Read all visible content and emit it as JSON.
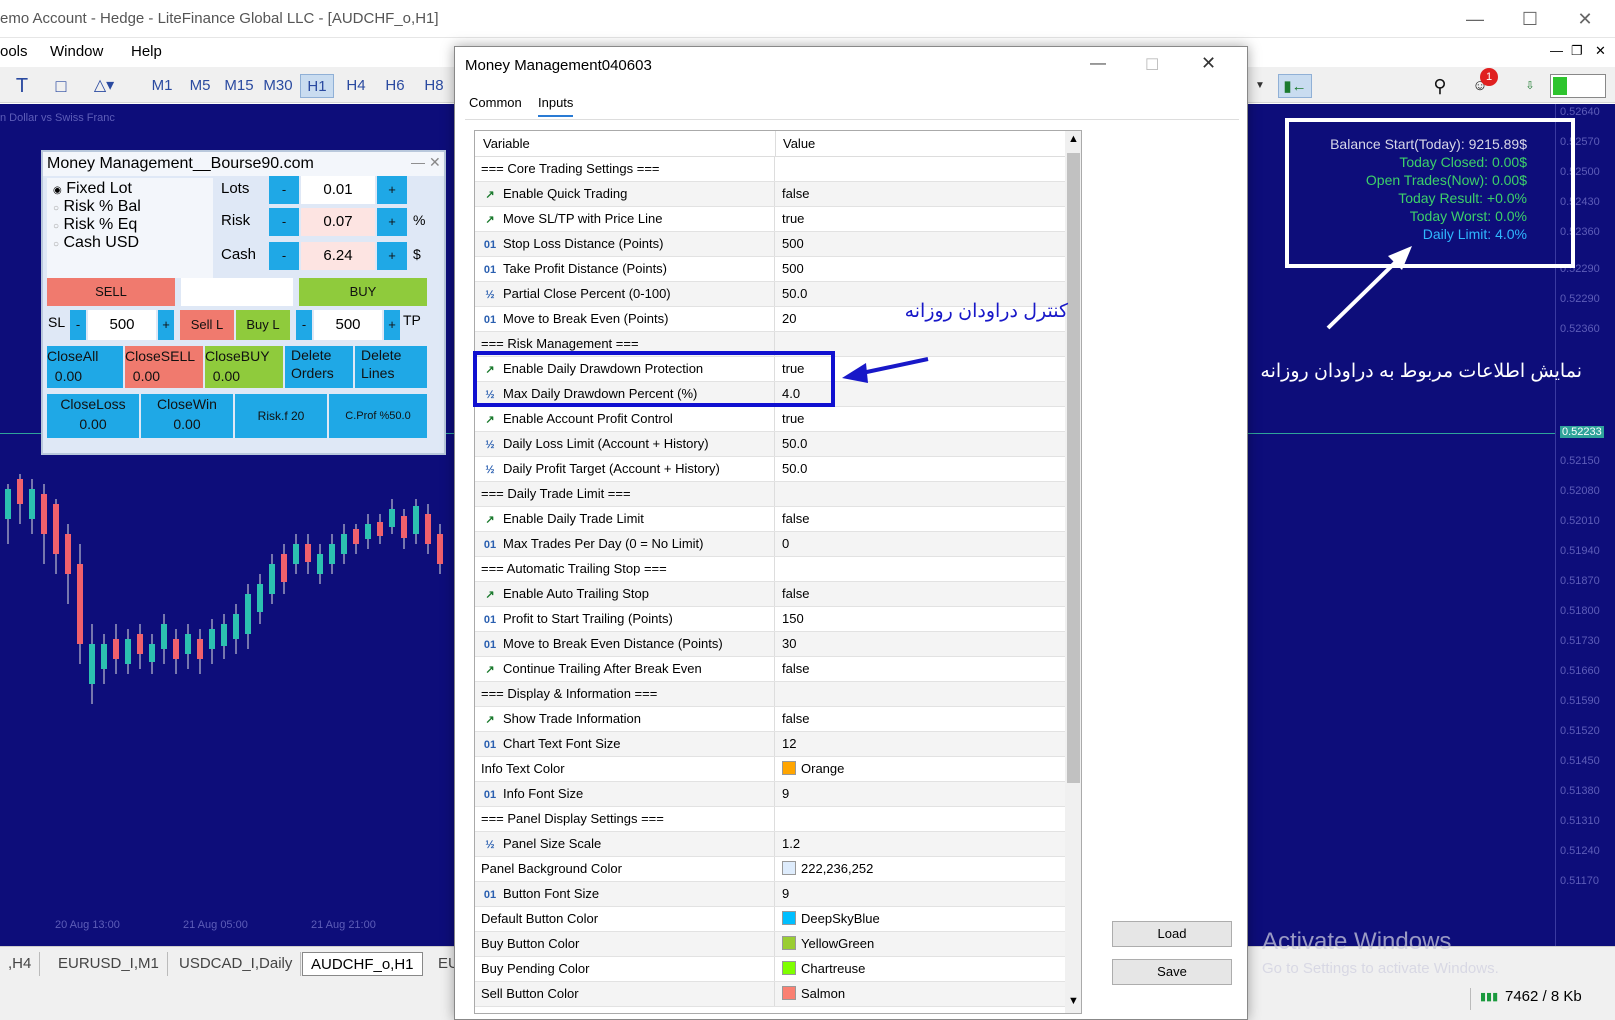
{
  "window": {
    "title": "emo Account - Hedge - LiteFinance Global LLC - [AUDCHF_o,H1]"
  },
  "menu": [
    "ools",
    "Window",
    "Help"
  ],
  "timeframes": [
    "M1",
    "M5",
    "M15",
    "M30",
    "H1",
    "H4",
    "H6",
    "H8"
  ],
  "chart": {
    "symbol_label": "n Dollar vs Swiss Franc",
    "prices": [
      "0.52640",
      "0.52570",
      "0.52500",
      "0.52430",
      "0.52360",
      "0.52290",
      "0.52220",
      "0.52150",
      "0.52080",
      "0.52010",
      "0.51940",
      "0.51870",
      "0.51800",
      "0.51730",
      "0.51660",
      "0.51590",
      "0.51520",
      "0.51450",
      "0.51380",
      "0.51310",
      "0.51240",
      "0.51170"
    ],
    "current_price": "0.52233",
    "time_labels": [
      "20 Aug 13:00",
      "21 Aug 05:00",
      "21 Aug 21:00"
    ]
  },
  "panel": {
    "title": "Money Management__Bourse90.com",
    "modes": [
      "Fixed Lot",
      "Risk % Bal",
      "Risk % Eq",
      "Cash USD"
    ],
    "lots_label": "Lots",
    "lots": "0.01",
    "risk_label": "Risk",
    "risk": "0.07",
    "risk_unit": "%",
    "cash_label": "Cash",
    "cash": "6.24",
    "cash_unit": "$",
    "minus": "-",
    "plus": "+",
    "sell": "SELL",
    "buy": "BUY",
    "sl_label": "SL",
    "sl": "500",
    "sell_l": "Sell L",
    "buy_l": "Buy L",
    "tp": "500",
    "tp_label": "TP",
    "close_all": "CloseAll",
    "close_all_val": "0.00",
    "close_sell": "CloseSELL",
    "close_sell_val": "0.00",
    "close_buy": "CloseBUY",
    "close_buy_val": "0.00",
    "delete_orders": "Delete Orders",
    "delete_lines": "Delete Lines",
    "close_loss": "CloseLoss",
    "close_loss_val": "0.00",
    "close_win": "CloseWin",
    "close_win_val": "0.00",
    "risk_f": "Risk.f 20",
    "c_prof": "C.Prof %50.0"
  },
  "info": {
    "balance": "Balance Start(Today): 9215.89$",
    "today_closed": "Today Closed: 0.00$",
    "open_trades": "Open Trades(Now): 0.00$",
    "today_result": "Today Result: +0.0%",
    "today_worst": "Today Worst: 0.0%",
    "daily_limit": "Daily Limit: 4.0%"
  },
  "annotations": {
    "control": "کنترل دراودان روزانه",
    "display": "نمایش اطلاعات مربوط به دراودان روزانه"
  },
  "watermark": {
    "title": "Activate Windows",
    "sub": "Go to Settings to activate Windows."
  },
  "chart_tabs": [
    ",H4",
    "EURUSD_I,M1",
    "USDCAD_I,Daily",
    "AUDCHF_o,H1",
    "EU"
  ],
  "status": {
    "traffic": "7462 / 8 Kb"
  },
  "notification_count": "1",
  "dialog": {
    "title": "Money Management040603",
    "tabs": [
      "Common",
      "Inputs"
    ],
    "col_variable": "Variable",
    "col_value": "Value",
    "load": "Load",
    "save": "Save",
    "rows": [
      {
        "icon": "",
        "name": "=== Core Trading Settings ===",
        "value": ""
      },
      {
        "icon": "bool",
        "name": "Enable Quick Trading",
        "value": "false"
      },
      {
        "icon": "bool",
        "name": "Move SL/TP with Price Line",
        "value": "true"
      },
      {
        "icon": "int",
        "name": "Stop Loss Distance (Points)",
        "value": "500"
      },
      {
        "icon": "int",
        "name": "Take Profit Distance (Points)",
        "value": "500"
      },
      {
        "icon": "dbl",
        "name": "Partial Close Percent (0-100)",
        "value": "50.0"
      },
      {
        "icon": "int",
        "name": "Move to Break Even (Points)",
        "value": "20"
      },
      {
        "icon": "",
        "name": "=== Risk Management ===",
        "value": ""
      },
      {
        "icon": "bool",
        "name": "Enable Daily Drawdown Protection",
        "value": "true"
      },
      {
        "icon": "dbl",
        "name": "Max Daily Drawdown Percent (%)",
        "value": "4.0"
      },
      {
        "icon": "bool",
        "name": "Enable Account Profit Control",
        "value": "true"
      },
      {
        "icon": "dbl",
        "name": "Daily Loss Limit (Account + History)",
        "value": "50.0"
      },
      {
        "icon": "dbl",
        "name": "Daily Profit Target (Account + History)",
        "value": "50.0"
      },
      {
        "icon": "",
        "name": "=== Daily Trade Limit ===",
        "value": ""
      },
      {
        "icon": "bool",
        "name": "Enable Daily Trade Limit",
        "value": "false"
      },
      {
        "icon": "int",
        "name": "Max Trades Per Day (0 = No Limit)",
        "value": "0"
      },
      {
        "icon": "",
        "name": "=== Automatic Trailing Stop ===",
        "value": ""
      },
      {
        "icon": "bool",
        "name": "Enable Auto Trailing Stop",
        "value": "false"
      },
      {
        "icon": "int",
        "name": "Profit to Start Trailing (Points)",
        "value": "150"
      },
      {
        "icon": "int",
        "name": "Move to Break Even Distance (Points)",
        "value": "30"
      },
      {
        "icon": "bool",
        "name": "Continue Trailing After Break Even",
        "value": "false"
      },
      {
        "icon": "",
        "name": "=== Display & Information ===",
        "value": ""
      },
      {
        "icon": "bool",
        "name": "Show Trade Information",
        "value": "false"
      },
      {
        "icon": "int",
        "name": "Chart Text Font Size",
        "value": "12"
      },
      {
        "icon": "color",
        "name": "Info Text Color",
        "value": "Orange",
        "swatch": "#ffa500"
      },
      {
        "icon": "int",
        "name": "Info Font Size",
        "value": "9"
      },
      {
        "icon": "",
        "name": "=== Panel Display Settings ===",
        "value": ""
      },
      {
        "icon": "dbl",
        "name": "Panel Size Scale",
        "value": "1.2"
      },
      {
        "icon": "color",
        "name": "Panel Background Color",
        "value": "222,236,252",
        "swatch": "#deecfc"
      },
      {
        "icon": "int",
        "name": "Button Font Size",
        "value": "9"
      },
      {
        "icon": "color",
        "name": "Default Button Color",
        "value": "DeepSkyBlue",
        "swatch": "#00bfff"
      },
      {
        "icon": "color",
        "name": "Buy Button Color",
        "value": "YellowGreen",
        "swatch": "#9acd32"
      },
      {
        "icon": "color",
        "name": "Buy Pending Color",
        "value": "Chartreuse",
        "swatch": "#7fff00"
      },
      {
        "icon": "color",
        "name": "Sell Button Color",
        "value": "Salmon",
        "swatch": "#fa8072"
      }
    ]
  }
}
